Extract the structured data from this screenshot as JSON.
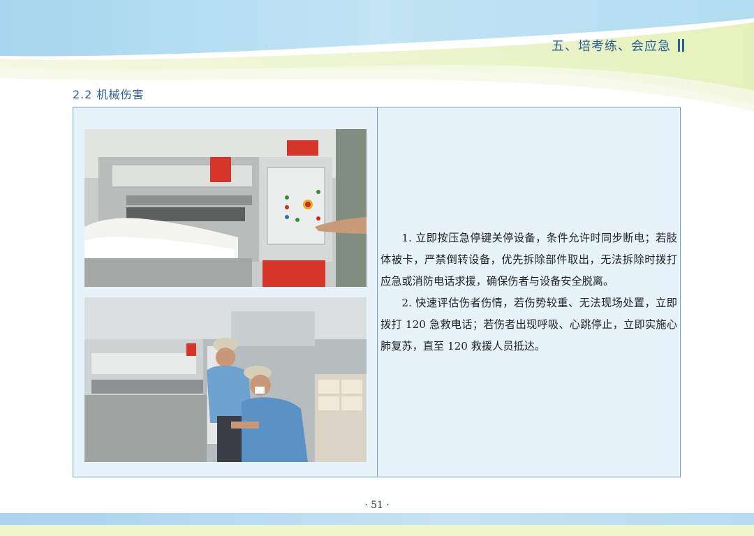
{
  "header": {
    "chapter_title": "五、培考练、会应急"
  },
  "section": {
    "title": "2.2 机械伤害"
  },
  "content": {
    "paragraphs": [
      "1. 立即按压急停键关停设备，条件允许时同步断电；若肢体被卡，严禁倒转设备，优先拆除部件取出，无法拆除时拨打应急或消防电话求援，确保伤者与设备安全脱离。",
      "2. 快速评估伤者伤情，若伤势较重、无法现场处置，立即拨打 120 急救电话；若伤者出现呼吸、心跳停止，立即实施心肺复苏，直至 120 救援人员抵达。"
    ]
  },
  "footer": {
    "page_number": "· 51 ·"
  },
  "colors": {
    "accent": "#2a5f9a",
    "table_bg": "#e6f3fb",
    "table_border": "#7a9fc4"
  }
}
